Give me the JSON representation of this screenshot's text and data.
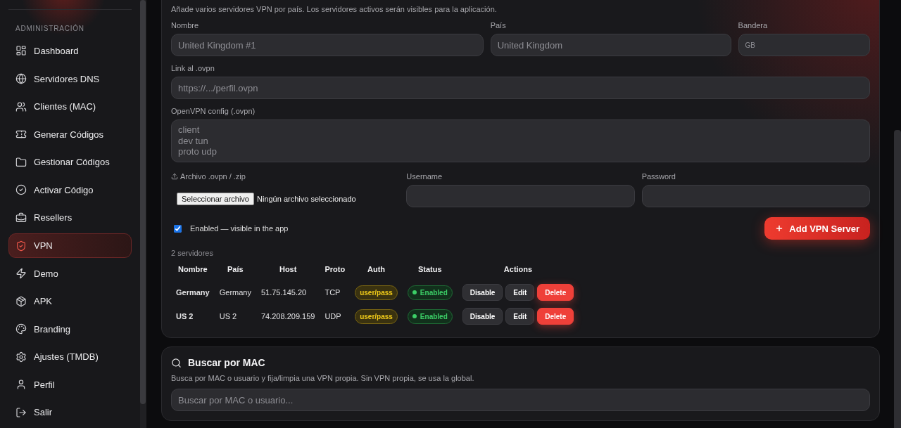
{
  "sidebar": {
    "section_label": "ADMINISTRACIÓN",
    "items": [
      {
        "label": "Dashboard",
        "selected": false
      },
      {
        "label": "Servidores DNS",
        "selected": false
      },
      {
        "label": "Clientes (MAC)",
        "selected": false
      },
      {
        "label": "Generar Códigos",
        "selected": false
      },
      {
        "label": "Gestionar Códigos",
        "selected": false
      },
      {
        "label": "Activar Código",
        "selected": false
      },
      {
        "label": "Resellers",
        "selected": false
      },
      {
        "label": "VPN",
        "selected": true
      },
      {
        "label": "Demo",
        "selected": false
      },
      {
        "label": "APK",
        "selected": false
      },
      {
        "label": "Branding",
        "selected": false
      },
      {
        "label": "Ajustes (TMDB)",
        "selected": false
      },
      {
        "label": "Perfil",
        "selected": false
      },
      {
        "label": "Salir",
        "selected": false
      }
    ]
  },
  "vpn_form": {
    "description": "Añade varios servidores VPN por país. Los servidores activos serán visibles para la aplicación.",
    "name": {
      "label": "Nombre",
      "placeholder": "United Kingdom #1"
    },
    "country": {
      "label": "País",
      "placeholder": "United Kingdom"
    },
    "flag": {
      "label": "Bandera",
      "placeholder": "GB"
    },
    "link": {
      "label": "Link al .ovpn",
      "placeholder": "https://.../perfil.ovpn"
    },
    "config": {
      "label": "OpenVPN config (.ovpn)",
      "placeholder": "client\ndev tun\nproto udp"
    },
    "file": {
      "label": "Archivo .ovpn / .zip",
      "button": "Seleccionar archivo",
      "status": "Ningún archivo seleccionado"
    },
    "username": {
      "label": "Username"
    },
    "password": {
      "label": "Password"
    },
    "enabled": {
      "label": "Enabled — visible in the app",
      "checked": true
    },
    "add_button": "Add VPN Server"
  },
  "servers": {
    "count": "2 servidores",
    "columns": [
      "Nombre",
      "País",
      "Host",
      "Proto",
      "Auth",
      "Status",
      "Actions"
    ],
    "rows": [
      {
        "name": "Germany",
        "country": "Germany",
        "host": "51.75.145.20",
        "proto": "TCP",
        "auth": "user/pass",
        "status": "Enabled",
        "enabled": true,
        "actions": [
          {
            "label": "Disable",
            "kind": "neutral"
          },
          {
            "label": "Edit",
            "kind": "neutral"
          },
          {
            "label": "Delete",
            "kind": "danger"
          }
        ]
      },
      {
        "name": "US 2",
        "country": "US 2",
        "host": "74.208.209.159",
        "proto": "UDP",
        "auth": "user/pass",
        "status": "Enabled",
        "enabled": true,
        "actions": [
          {
            "label": "Disable",
            "kind": "neutral"
          },
          {
            "label": "Edit",
            "kind": "neutral"
          },
          {
            "label": "Delete",
            "kind": "danger"
          }
        ]
      }
    ]
  },
  "mac_search": {
    "title": "Buscar por MAC",
    "description": "Busca por MAC o usuario y fija/limpia una VPN propia. Sin VPN propia, se usa la global.",
    "placeholder": "Buscar por MAC o usuario..."
  }
}
